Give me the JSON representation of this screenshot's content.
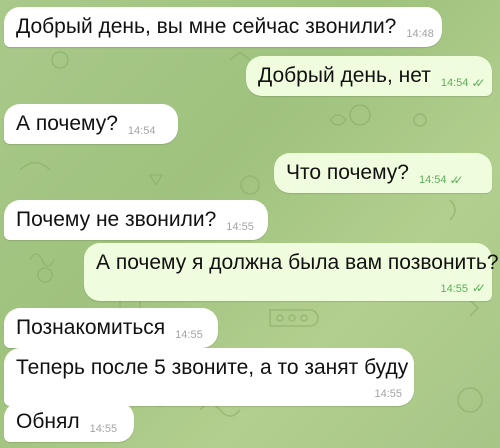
{
  "messages": [
    {
      "id": "m1",
      "direction": "in",
      "text": "Добрый день, вы мне сейчас звонили?",
      "time": "14:48"
    },
    {
      "id": "m2",
      "direction": "out",
      "text": "Добрый день, нет",
      "time": "14:54",
      "status": "read"
    },
    {
      "id": "m3",
      "direction": "in",
      "text": "А почему?",
      "time": "14:54"
    },
    {
      "id": "m4",
      "direction": "out",
      "text": "Что почему?",
      "time": "14:54",
      "status": "read"
    },
    {
      "id": "m5",
      "direction": "in",
      "text": "Почему не звонили?",
      "time": "14:55"
    },
    {
      "id": "m6",
      "direction": "out",
      "text": "А почему я должна была вам позвонить?",
      "time": "14:55",
      "status": "read"
    },
    {
      "id": "m7",
      "direction": "in",
      "text": "Познакомиться",
      "time": "14:55"
    },
    {
      "id": "m8",
      "direction": "in",
      "text": "Теперь после 5 звоните, а то занят буду",
      "time": "14:55"
    },
    {
      "id": "m9",
      "direction": "in",
      "text": "Обнял",
      "time": "14:55"
    }
  ],
  "colors": {
    "incoming_bubble": "#ffffff",
    "outgoing_bubble": "#effdde",
    "read_ticks": "#5fae5a",
    "wallpaper": "#a9c98a"
  },
  "icons": {
    "read_status": "double-check-icon"
  }
}
